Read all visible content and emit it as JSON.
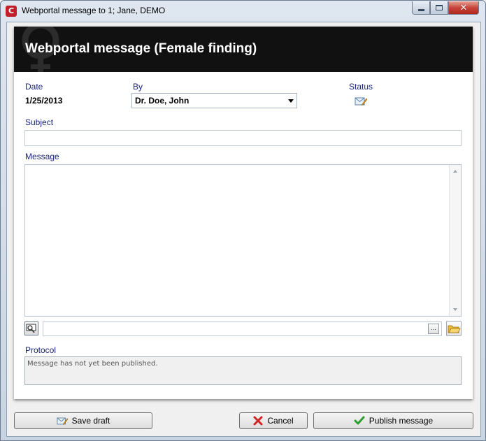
{
  "window": {
    "title": "Webportal message to 1; Jane, DEMO"
  },
  "header": {
    "title": "Webportal message (Female finding)"
  },
  "fields": {
    "date_label": "Date",
    "date_value": "1/25/2013",
    "by_label": "By",
    "by_selected": "Dr. Doe, John",
    "status_label": "Status",
    "subject_label": "Subject",
    "subject_value": "",
    "message_label": "Message",
    "message_value": "",
    "attachment_value": "",
    "attachment_browse_label": "...",
    "protocol_label": "Protocol",
    "protocol_text": "Message has not yet been published."
  },
  "buttons": {
    "save_draft": "Save draft",
    "cancel": "Cancel",
    "publish": "Publish message"
  },
  "colors": {
    "label": "#1a237e",
    "header_bg": "#111111",
    "cancel_icon": "#d22222",
    "publish_icon": "#2e9e2e"
  },
  "icons": {
    "app": "app-logo-icon",
    "status": "envelope-edit-icon",
    "attach": "magnifier-screen-icon",
    "folder": "folder-open-icon",
    "save": "envelope-edit-icon",
    "cancel": "x-icon",
    "publish": "checkmark-icon"
  }
}
